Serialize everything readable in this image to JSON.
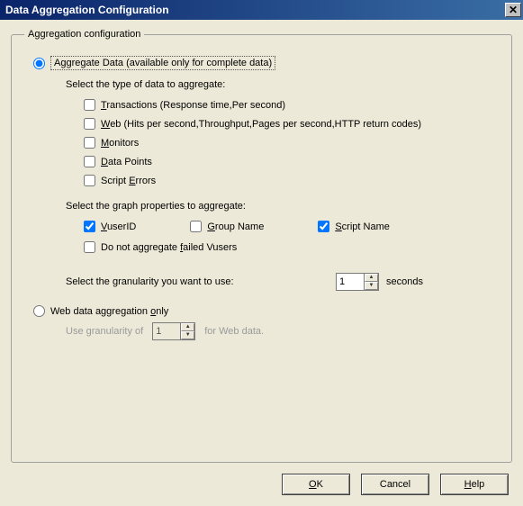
{
  "title": "Data Aggregation Configuration",
  "groupbox_legend": "Aggregation configuration",
  "radio_aggregate": {
    "label": "Aggregate Data (available only for complete data)",
    "checked": true
  },
  "type_section_label": "Select the type of data to aggregate:",
  "type_checks": {
    "transactions": {
      "label": "Transactions (Response time,Per second)",
      "checked": false
    },
    "web": {
      "label": "Web (Hits per second,Throughput,Pages per second,HTTP return codes)",
      "checked": false
    },
    "monitors": {
      "label": "Monitors",
      "checked": false
    },
    "datapoints": {
      "label": "Data Points",
      "checked": false
    },
    "scripterrors": {
      "label": "Script Errors",
      "checked": false
    }
  },
  "props_section_label": "Select the graph properties to aggregate:",
  "props_checks": {
    "vuserid": {
      "label": "VuserID",
      "checked": true
    },
    "groupname": {
      "label": "Group Name",
      "checked": false
    },
    "scriptname": {
      "label": "Script Name",
      "checked": true
    },
    "noaggfailed": {
      "label": "Do not aggregate failed Vusers",
      "checked": false
    }
  },
  "granularity": {
    "label": "Select the granularity you want to use:",
    "value": "1",
    "unit": "seconds"
  },
  "radio_webonly": {
    "label": "Web data aggregation only",
    "checked": false
  },
  "web_granularity": {
    "pre": "Use granularity of",
    "value": "1",
    "post": "for Web data."
  },
  "buttons": {
    "ok": "OK",
    "cancel": "Cancel",
    "help": "Help"
  }
}
